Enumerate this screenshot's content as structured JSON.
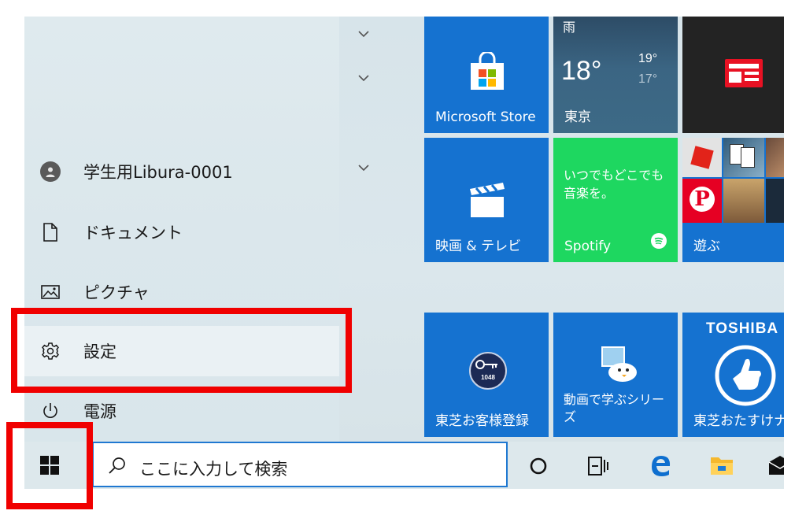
{
  "start_menu": {
    "user_name": "学生用Libura-0001",
    "items": [
      {
        "label": "ドキュメント",
        "icon": "document-icon"
      },
      {
        "label": "ピクチャ",
        "icon": "picture-icon"
      },
      {
        "label": "設定",
        "icon": "gear-icon"
      },
      {
        "label": "電源",
        "icon": "power-icon"
      }
    ]
  },
  "tiles": {
    "store": {
      "label": "Microsoft Store"
    },
    "weather": {
      "condition": "雨",
      "temp": "18°",
      "high": "19°",
      "low": "17°",
      "city": "東京"
    },
    "movies": {
      "label": "映画 & テレビ"
    },
    "spotify": {
      "tagline": "いつでもどこでも\n音楽を。",
      "label": "Spotify"
    },
    "games": {
      "label": "遊ぶ"
    },
    "toshiba_reg": {
      "label": "東芝お客様登録",
      "badge": "1048"
    },
    "learning": {
      "label": "動画で学ぶシリー\nズ"
    },
    "toshiba_help": {
      "brand": "TOSHIBA",
      "label": "東芝おたすけナ"
    }
  },
  "taskbar": {
    "search_placeholder": "ここに入力して検索"
  },
  "colors": {
    "accent": "#1572d0",
    "spotify_green": "#1ed760",
    "highlight": "#f00000"
  }
}
